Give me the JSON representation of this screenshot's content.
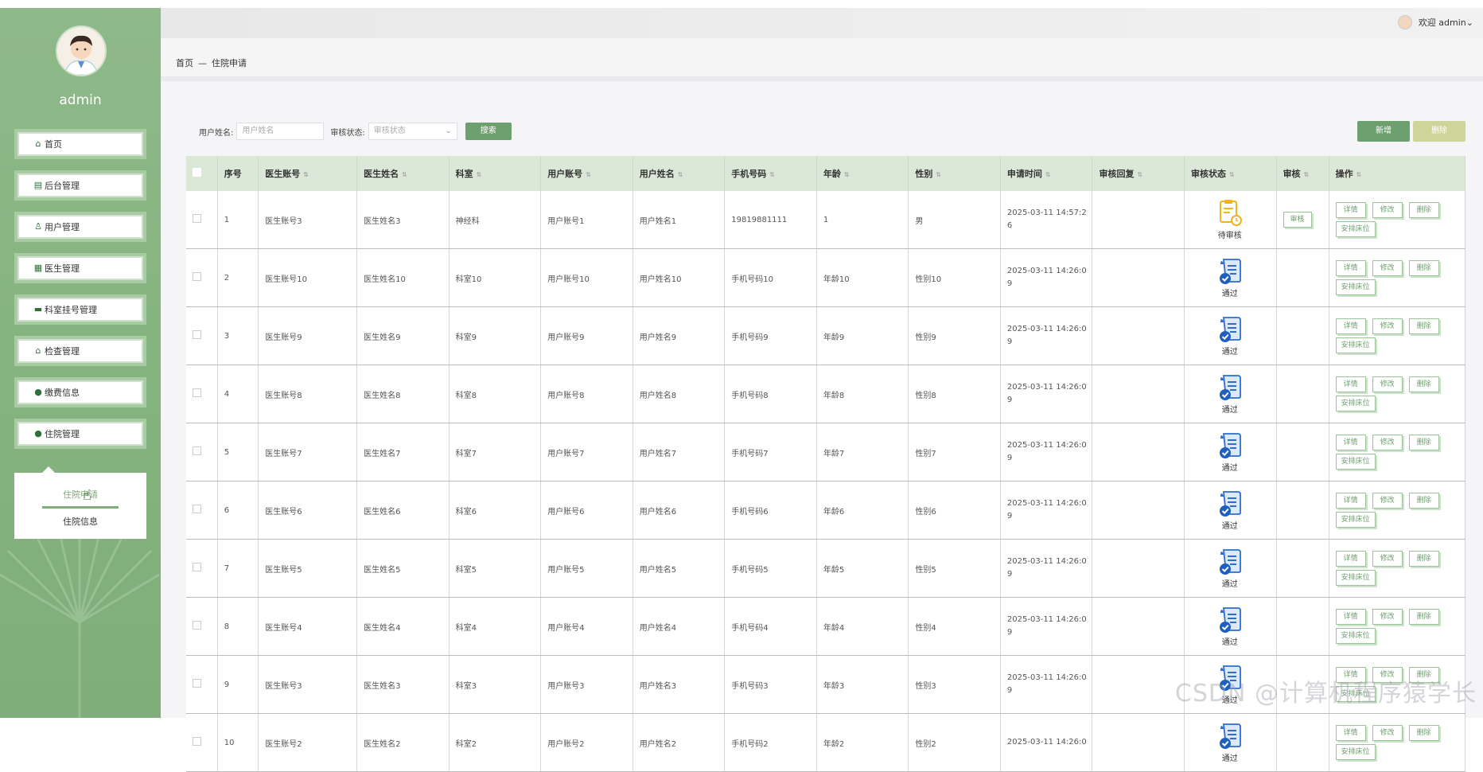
{
  "sidebar": {
    "username": "admin",
    "menu": [
      {
        "label": "首页",
        "icon": "home-icon"
      },
      {
        "label": "后台管理",
        "icon": "table-icon"
      },
      {
        "label": "用户管理",
        "icon": "user-icon"
      },
      {
        "label": "医生管理",
        "icon": "grid-icon"
      },
      {
        "label": "科室挂号管理",
        "icon": "folder-icon"
      },
      {
        "label": "检查管理",
        "icon": "bag-icon"
      },
      {
        "label": "缴费信息",
        "icon": "check-circle-icon"
      },
      {
        "label": "住院管理",
        "icon": "drop-icon"
      }
    ],
    "submenu": [
      {
        "label": "住院申请",
        "active": true
      },
      {
        "label": "住院信息",
        "active": false
      }
    ]
  },
  "header": {
    "welcome": "欢迎 admin"
  },
  "breadcrumb": {
    "home": "首页",
    "separator": "—",
    "current": "住院申请"
  },
  "filters": {
    "username_label": "用户姓名:",
    "username_placeholder": "用户姓名",
    "status_label": "审核状态:",
    "status_placeholder": "审核状态",
    "search_label": "搜索"
  },
  "actions": {
    "add_label": "新增",
    "delete_label": "删除"
  },
  "table": {
    "columns": [
      "序号",
      "医生账号",
      "医生姓名",
      "科室",
      "用户账号",
      "用户姓名",
      "手机号码",
      "年龄",
      "性别",
      "申请时间",
      "审核回复",
      "审核状态",
      "审核",
      "操作"
    ],
    "rows": [
      {
        "no": "1",
        "doctor_account": "医生账号3",
        "doctor_name": "医生姓名3",
        "dept": "神经科",
        "user_account": "用户账号1",
        "user_name": "用户姓名1",
        "phone": "19819881111",
        "age": "1",
        "gender": "男",
        "apply_time": "2025-03-11 14:57:26",
        "reply": "",
        "status": "待审核",
        "status_type": "pending",
        "show_audit": true
      },
      {
        "no": "2",
        "doctor_account": "医生账号10",
        "doctor_name": "医生姓名10",
        "dept": "科室10",
        "user_account": "用户账号10",
        "user_name": "用户姓名10",
        "phone": "手机号码10",
        "age": "年龄10",
        "gender": "性别10",
        "apply_time": "2025-03-11 14:26:09",
        "reply": "",
        "status": "通过",
        "status_type": "approved",
        "show_audit": false
      },
      {
        "no": "3",
        "doctor_account": "医生账号9",
        "doctor_name": "医生姓名9",
        "dept": "科室9",
        "user_account": "用户账号9",
        "user_name": "用户姓名9",
        "phone": "手机号码9",
        "age": "年龄9",
        "gender": "性别9",
        "apply_time": "2025-03-11 14:26:09",
        "reply": "",
        "status": "通过",
        "status_type": "approved",
        "show_audit": false
      },
      {
        "no": "4",
        "doctor_account": "医生账号8",
        "doctor_name": "医生姓名8",
        "dept": "科室8",
        "user_account": "用户账号8",
        "user_name": "用户姓名8",
        "phone": "手机号码8",
        "age": "年龄8",
        "gender": "性别8",
        "apply_time": "2025-03-11 14:26:09",
        "reply": "",
        "status": "通过",
        "status_type": "approved",
        "show_audit": false
      },
      {
        "no": "5",
        "doctor_account": "医生账号7",
        "doctor_name": "医生姓名7",
        "dept": "科室7",
        "user_account": "用户账号7",
        "user_name": "用户姓名7",
        "phone": "手机号码7",
        "age": "年龄7",
        "gender": "性别7",
        "apply_time": "2025-03-11 14:26:09",
        "reply": "",
        "status": "通过",
        "status_type": "approved",
        "show_audit": false
      },
      {
        "no": "6",
        "doctor_account": "医生账号6",
        "doctor_name": "医生姓名6",
        "dept": "科室6",
        "user_account": "用户账号6",
        "user_name": "用户姓名6",
        "phone": "手机号码6",
        "age": "年龄6",
        "gender": "性别6",
        "apply_time": "2025-03-11 14:26:09",
        "reply": "",
        "status": "通过",
        "status_type": "approved",
        "show_audit": false
      },
      {
        "no": "7",
        "doctor_account": "医生账号5",
        "doctor_name": "医生姓名5",
        "dept": "科室5",
        "user_account": "用户账号5",
        "user_name": "用户姓名5",
        "phone": "手机号码5",
        "age": "年龄5",
        "gender": "性别5",
        "apply_time": "2025-03-11 14:26:09",
        "reply": "",
        "status": "通过",
        "status_type": "approved",
        "show_audit": false
      },
      {
        "no": "8",
        "doctor_account": "医生账号4",
        "doctor_name": "医生姓名4",
        "dept": "科室4",
        "user_account": "用户账号4",
        "user_name": "用户姓名4",
        "phone": "手机号码4",
        "age": "年龄4",
        "gender": "性别4",
        "apply_time": "2025-03-11 14:26:09",
        "reply": "",
        "status": "通过",
        "status_type": "approved",
        "show_audit": false
      },
      {
        "no": "9",
        "doctor_account": "医生账号3",
        "doctor_name": "医生姓名3",
        "dept": "科室3",
        "user_account": "用户账号3",
        "user_name": "用户姓名3",
        "phone": "手机号码3",
        "age": "年龄3",
        "gender": "性别3",
        "apply_time": "2025-03-11 14:26:09",
        "reply": "",
        "status": "通过",
        "status_type": "approved",
        "show_audit": false
      },
      {
        "no": "10",
        "doctor_account": "医生账号2",
        "doctor_name": "医生姓名2",
        "dept": "科室2",
        "user_account": "用户账号2",
        "user_name": "用户姓名2",
        "phone": "手机号码2",
        "age": "年龄2",
        "gender": "性别2",
        "apply_time": "2025-03-11 14:26:0",
        "reply": "",
        "status": "通过",
        "status_type": "approved",
        "show_audit": false
      }
    ],
    "audit_label": "审核",
    "op_labels": {
      "detail": "详情",
      "edit": "修改",
      "delete": "删除",
      "assign_bed": "安排床位"
    }
  },
  "watermark": "CSDN @计算机程序猿学长",
  "colors": {
    "sidebar_green": "#86b480",
    "accent": "#6e9f6f",
    "header_row": "#dbe8d8",
    "delete_btn": "#cfd59a"
  }
}
